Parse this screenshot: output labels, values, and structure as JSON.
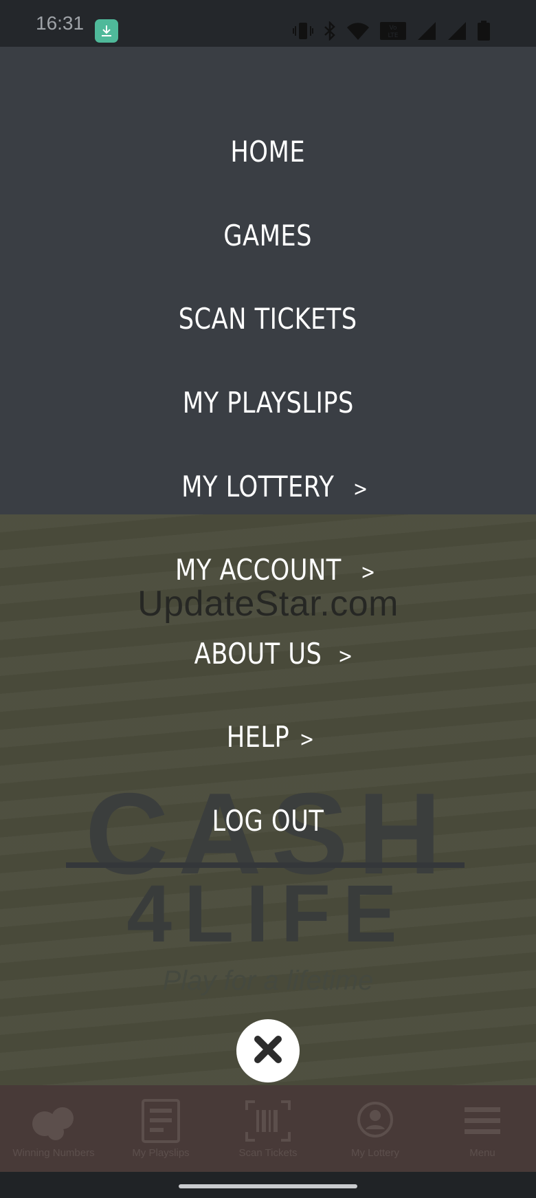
{
  "status_bar": {
    "time": "16:31",
    "icons": [
      "download-icon",
      "vibrate-icon",
      "bluetooth-icon",
      "wifi-icon",
      "volte-icon",
      "signal-icon",
      "signal-icon",
      "battery-icon"
    ],
    "volte_text": "Vo LTE"
  },
  "background": {
    "watermark": "UpdateStar.com",
    "logo_line1": "CASH",
    "logo_line2": "4LIFE",
    "logo_tagline": "Play for a lifetime"
  },
  "menu": {
    "items": [
      {
        "label": "HOME",
        "has_arrow": false
      },
      {
        "label": "GAMES",
        "has_arrow": false
      },
      {
        "label": "SCAN TICKETS",
        "has_arrow": false
      },
      {
        "label": "MY PLAYSLIPS",
        "has_arrow": false
      },
      {
        "label": "MY LOTTERY",
        "has_arrow": true
      },
      {
        "label": "MY ACCOUNT",
        "has_arrow": true
      },
      {
        "label": "ABOUT US",
        "has_arrow": true
      },
      {
        "label": "HELP",
        "has_arrow": true
      },
      {
        "label": "LOG OUT",
        "has_arrow": false
      }
    ],
    "arrow": ">",
    "close_icon": "close-icon"
  },
  "bottom_nav": {
    "items": [
      {
        "label": "Winning Numbers",
        "icon": "balls-icon"
      },
      {
        "label": "My Playslips",
        "icon": "playslip-icon"
      },
      {
        "label": "Scan Tickets",
        "icon": "barcode-scan-icon"
      },
      {
        "label": "My Lottery",
        "icon": "user-badge-icon"
      },
      {
        "label": "Menu",
        "icon": "hamburger-icon"
      }
    ]
  },
  "colors": {
    "overlay_top": "#3a3e44",
    "game_background": "#4b4c3c",
    "menu_text": "#ffffff",
    "status_bar": "#24272b",
    "download_badge": "#4fb99a",
    "bottom_nav": "#483a38"
  }
}
